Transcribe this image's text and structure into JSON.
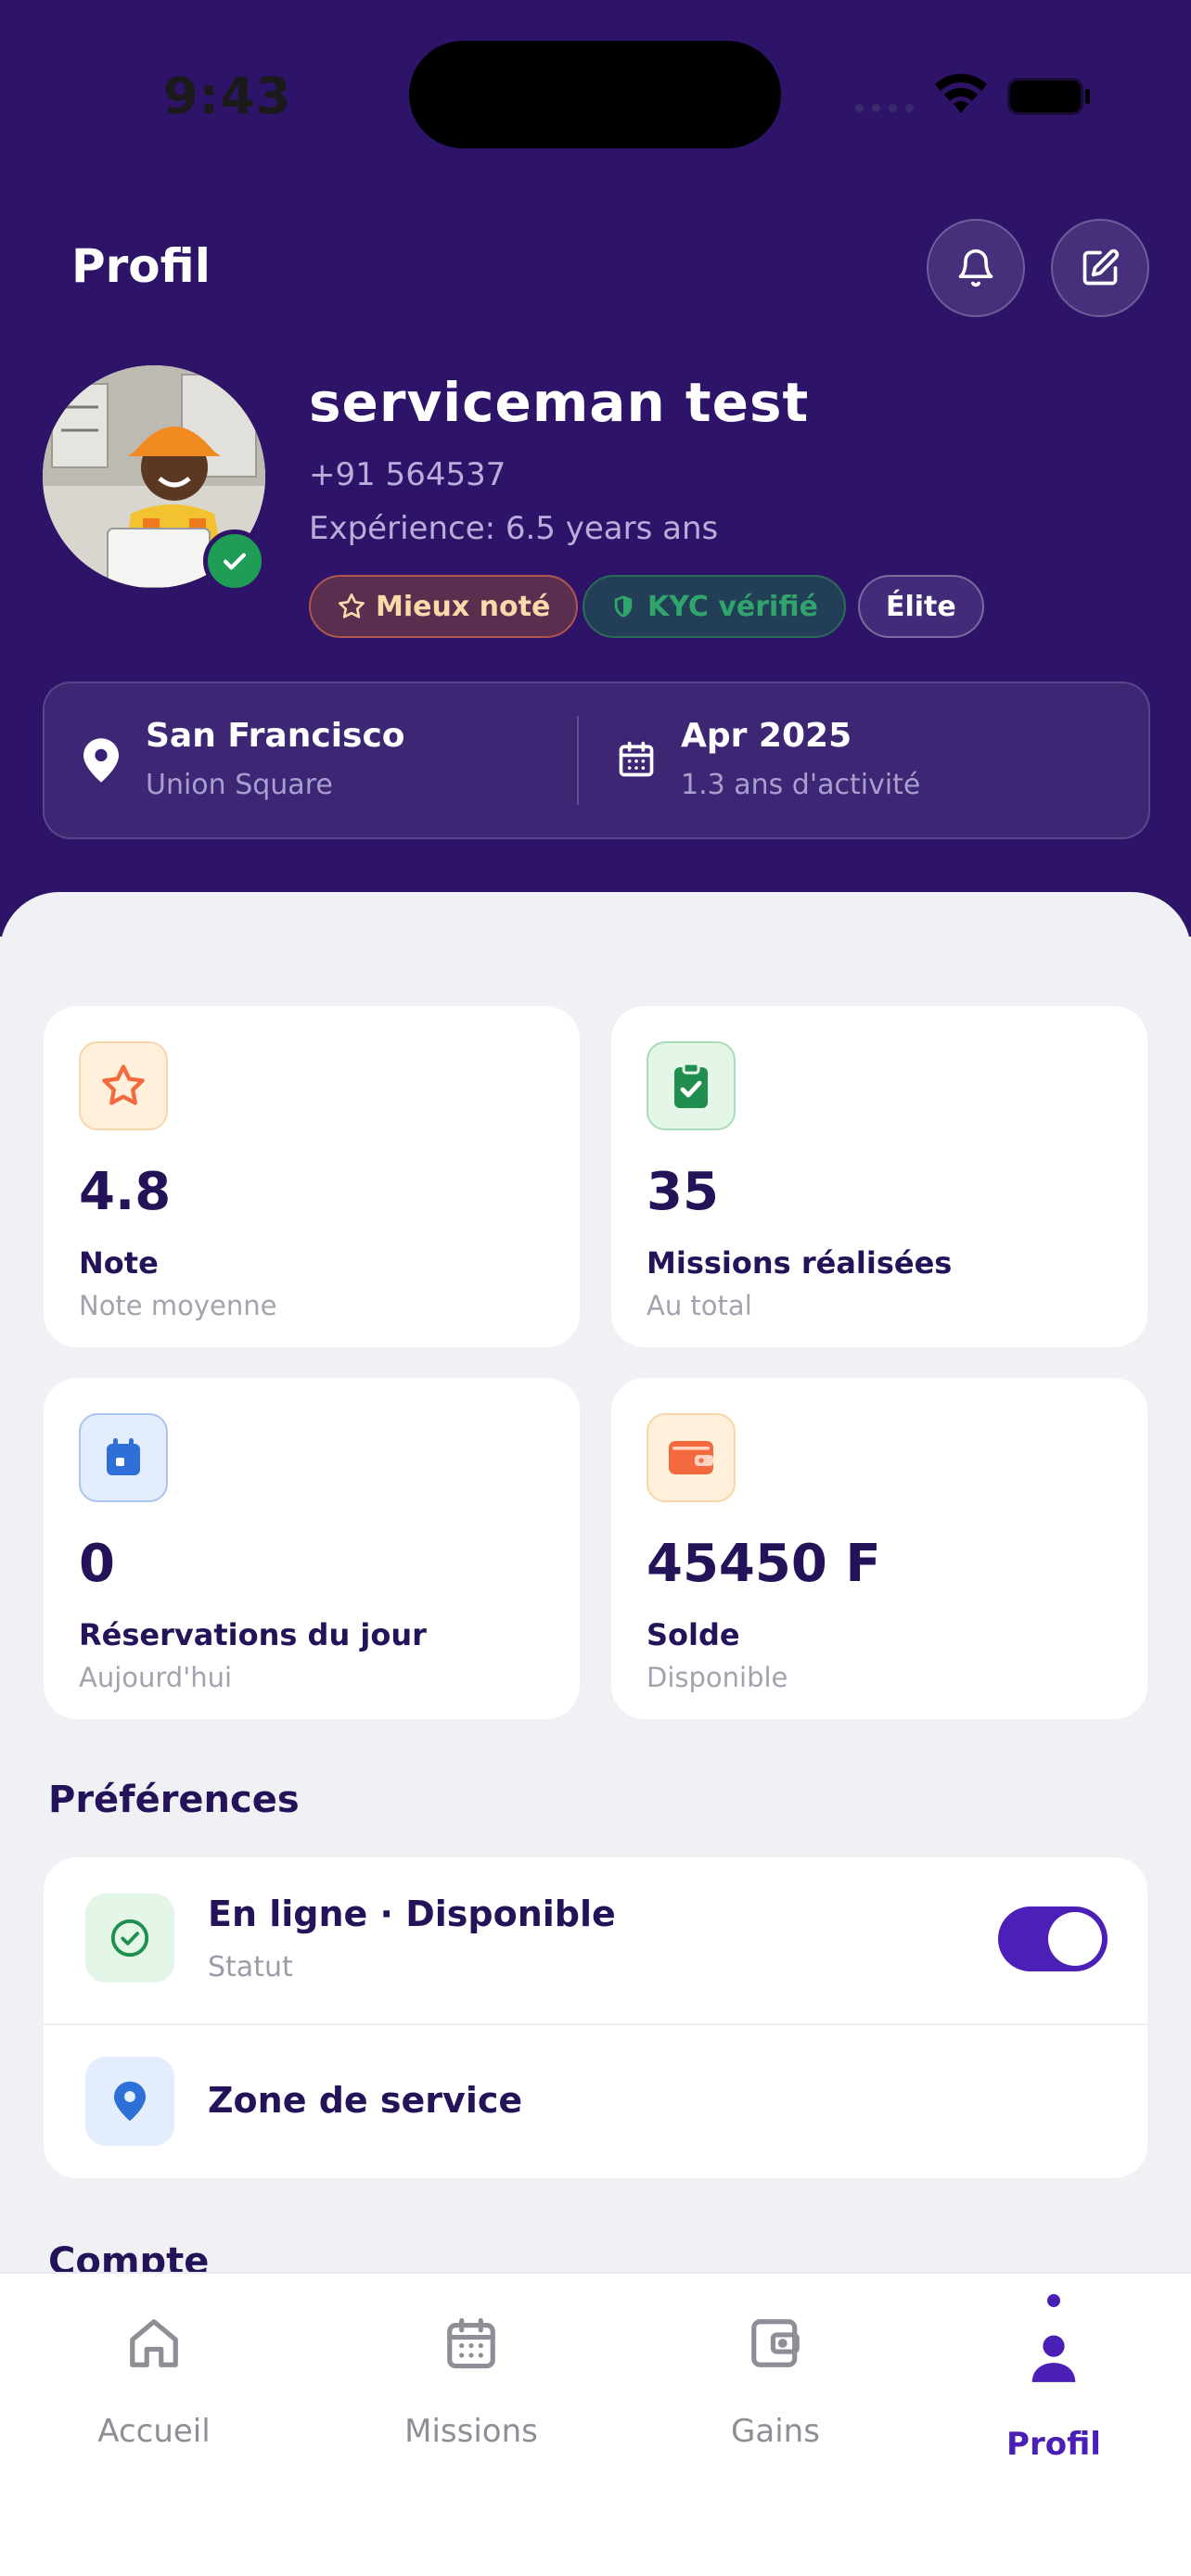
{
  "status_bar": {
    "time": "9:43"
  },
  "header": {
    "title": "Profil",
    "profile": {
      "name": "serviceman test",
      "phone": "+91 564537",
      "experience": "Expérience: 6.5 years ans",
      "badges": [
        {
          "label": "Mieux noté",
          "icon": "star-icon"
        },
        {
          "label": "KYC vérifié",
          "icon": "shield-icon"
        },
        {
          "label": "Élite"
        }
      ]
    },
    "location": {
      "city": "San Francisco",
      "area": "Union Square",
      "icon": "map-pin-icon"
    },
    "since": {
      "date": "Apr 2025",
      "duration": "1.3 ans d'activité",
      "icon": "calendar-icon"
    }
  },
  "stats": [
    {
      "value": "4.8",
      "label": "Note",
      "sub": "Note moyenne",
      "icon": "star-icon",
      "color": "#F26A3D"
    },
    {
      "value": "35",
      "label": "Missions réalisées",
      "sub": "Au total",
      "icon": "clipboard-check-icon",
      "color": "#1F8E4E"
    },
    {
      "value": "0",
      "label": "Réservations du jour",
      "sub": "Aujourd'hui",
      "icon": "calendar-icon",
      "color": "#2F6FD8"
    },
    {
      "value": "45450 F",
      "label": "Solde",
      "sub": "Disponible",
      "icon": "wallet-icon",
      "color": "#F26A3D"
    }
  ],
  "preferences": {
    "title": "Préférences",
    "status": {
      "title": "En ligne · Disponible",
      "sub": "Statut",
      "enabled": true
    },
    "zone": {
      "title": "Zone de service"
    }
  },
  "account": {
    "title": "Compte"
  },
  "tabs": [
    {
      "label": "Accueil",
      "icon": "home-icon"
    },
    {
      "label": "Missions",
      "icon": "calendar-icon"
    },
    {
      "label": "Gains",
      "icon": "wallet-icon"
    },
    {
      "label": "Profil",
      "icon": "user-icon",
      "active": true
    }
  ],
  "colors": {
    "header_bg": "#2D1469",
    "accent": "#4A1FB5",
    "text_dark": "#241359"
  }
}
